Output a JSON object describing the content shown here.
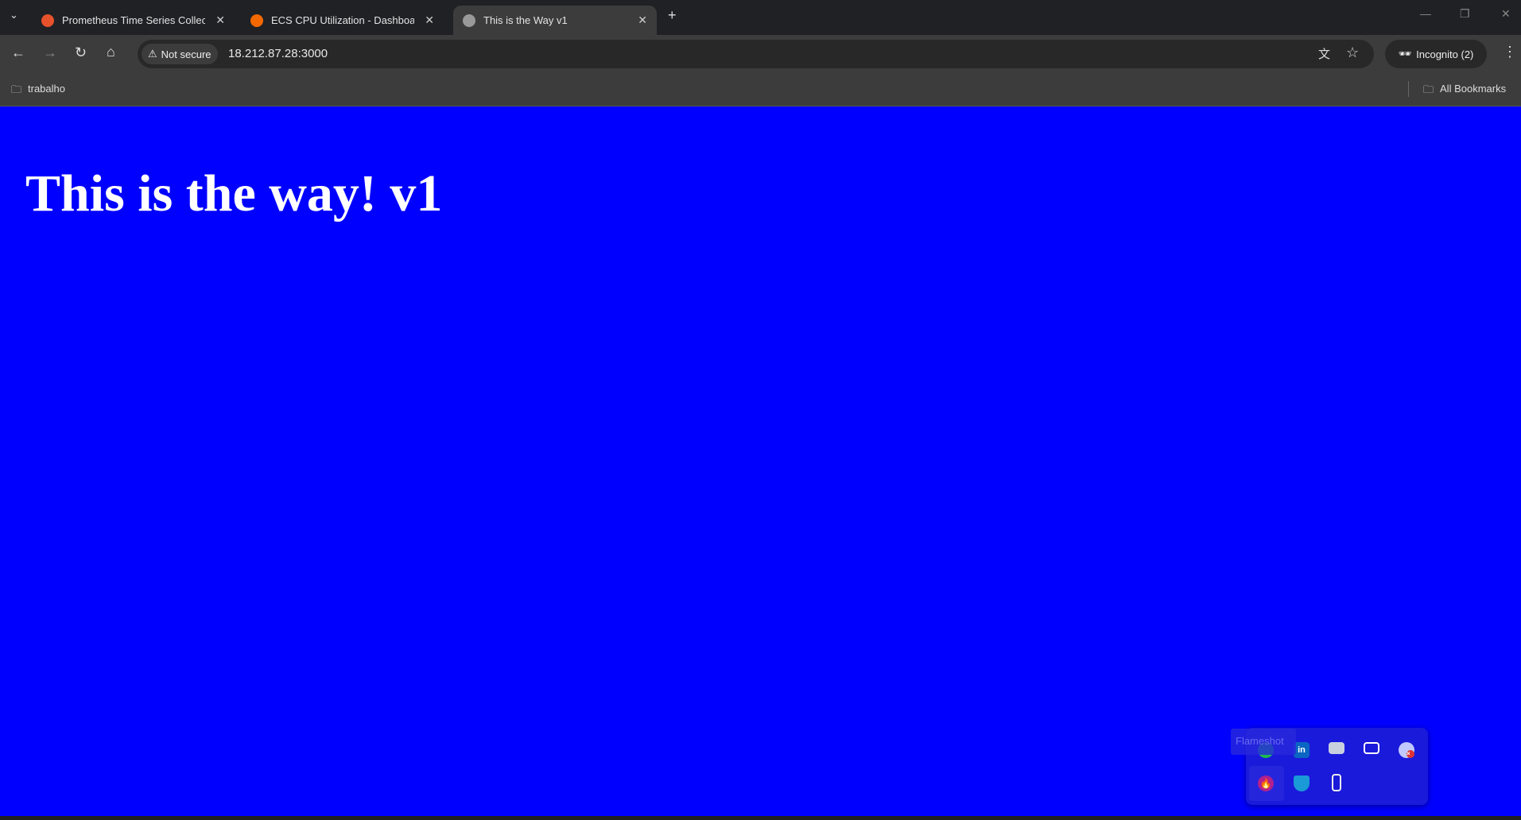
{
  "tabs": [
    {
      "title": "Prometheus Time Series Collec",
      "icon": "prometheus-icon",
      "color": "#e6522c"
    },
    {
      "title": "ECS CPU Utilization - Dashboard",
      "icon": "grafana-icon",
      "color": "#f46800"
    },
    {
      "title": "This is the Way v1",
      "icon": "globe-icon",
      "active": true
    }
  ],
  "toolbar": {
    "security": "Not secure",
    "url": "18.212.87.28:3000",
    "incognito": "Incognito (2)"
  },
  "bookmarks": {
    "folder": "trabalho",
    "all": "All Bookmarks"
  },
  "page": {
    "heading": "This is the way! v1",
    "background": "#0000ff"
  },
  "tray": {
    "tooltip": "Flameshot",
    "icons": [
      "spotify-icon",
      "linkedin-icon",
      "display-icon",
      "remote-desktop-icon",
      "onedrive-error-icon",
      "flameshot-icon",
      "defender-icon",
      "usb-eject-icon"
    ]
  }
}
